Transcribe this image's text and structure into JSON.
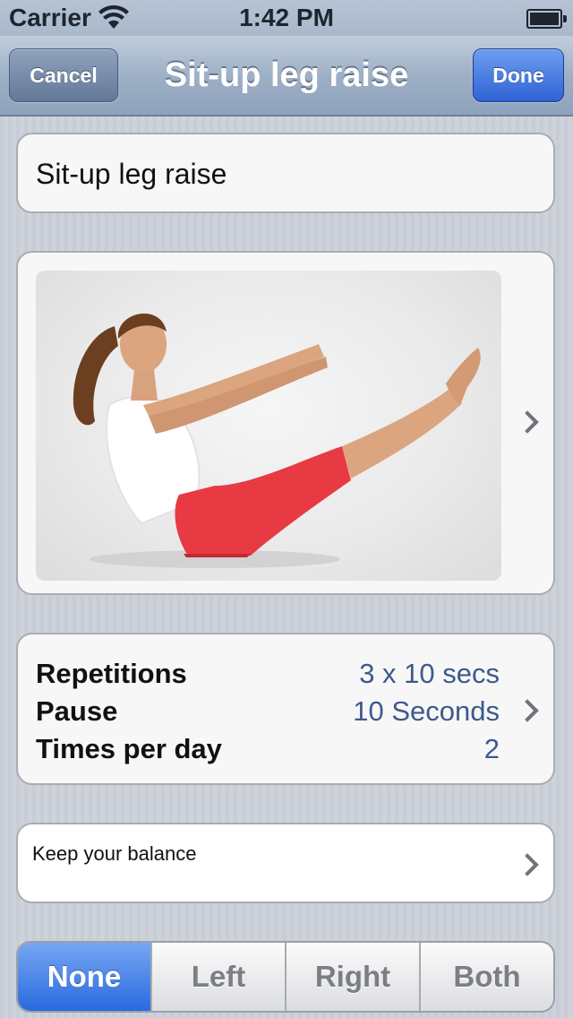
{
  "status_bar": {
    "carrier": "Carrier",
    "time": "1:42 PM"
  },
  "nav": {
    "title": "Sit-up leg raise",
    "cancel_label": "Cancel",
    "done_label": "Done"
  },
  "exercise": {
    "name": "Sit-up leg raise"
  },
  "settings": {
    "rows": [
      {
        "label": "Repetitions",
        "value": "3 x 10 secs"
      },
      {
        "label": "Pause",
        "value": "10 Seconds"
      },
      {
        "label": "Times per day",
        "value": "2"
      }
    ]
  },
  "note": {
    "text": "Keep your balance"
  },
  "side_selector": {
    "options": [
      "None",
      "Left",
      "Right",
      "Both"
    ],
    "selected": "None"
  },
  "colors": {
    "accent": "#2f62d4",
    "value_text": "#3d5a8c"
  }
}
